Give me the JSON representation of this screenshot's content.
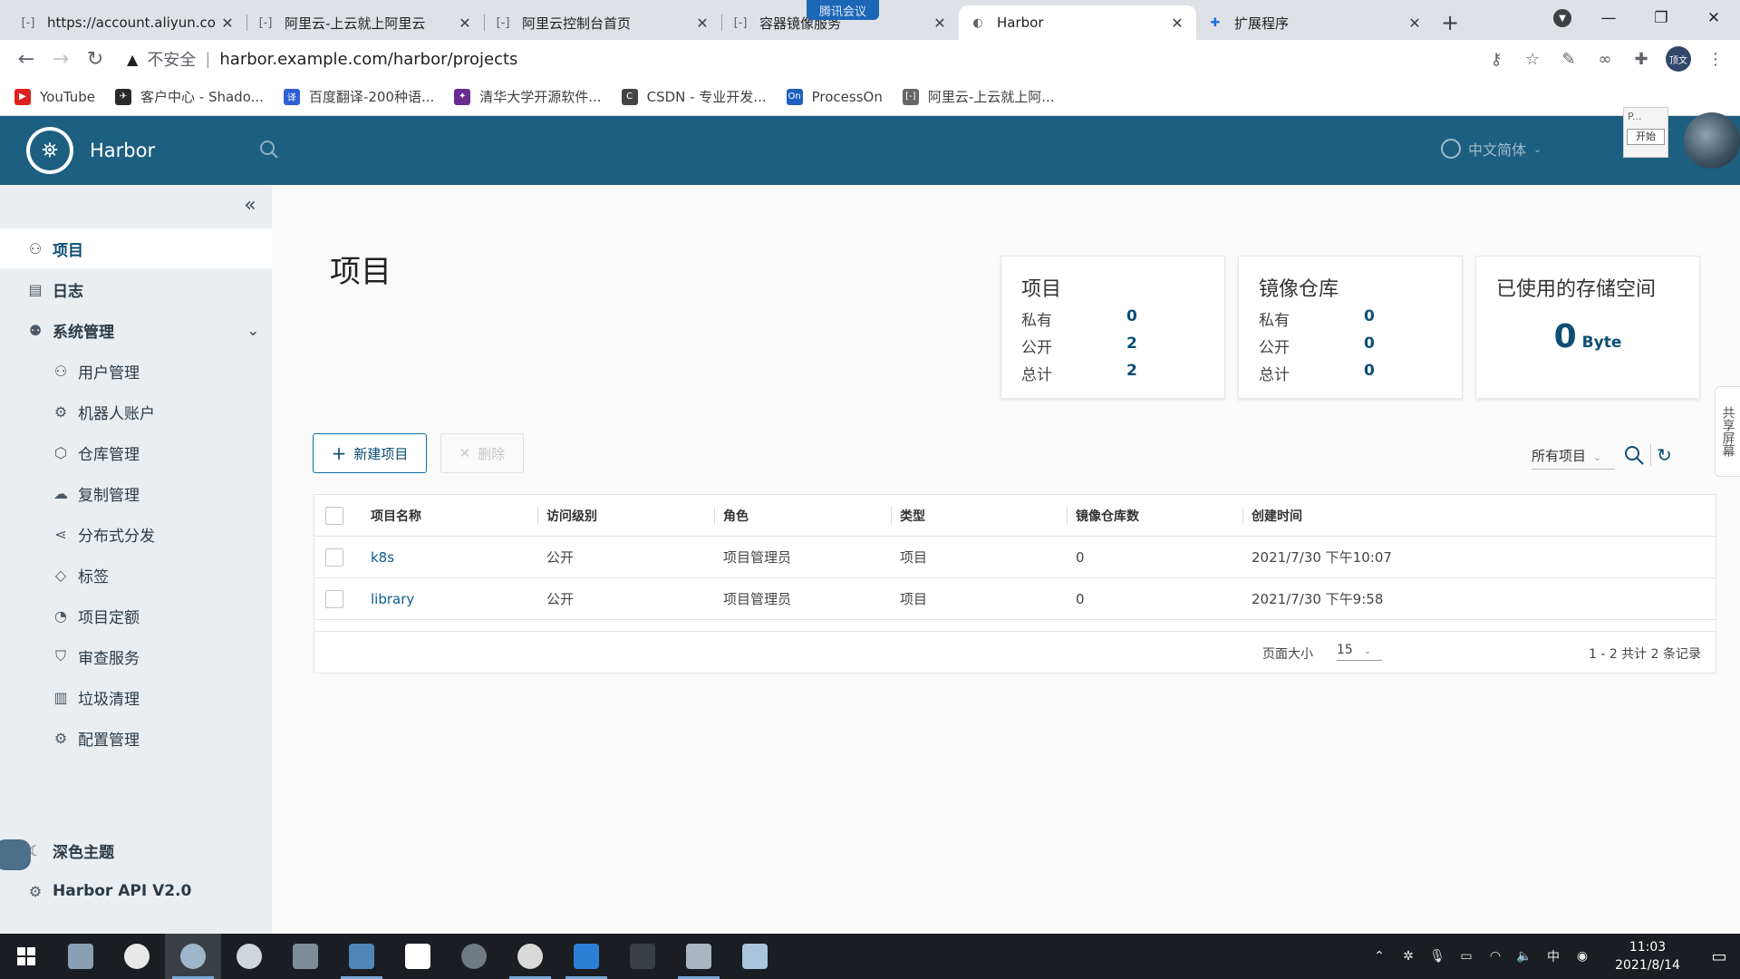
{
  "browser": {
    "tabs": [
      {
        "title": "https://account.aliyun.co",
        "icon": "page-icon",
        "active": false
      },
      {
        "title": "阿里云-上云就上阿里云",
        "icon": "page-icon",
        "active": false
      },
      {
        "title": "阿里云控制台首页",
        "icon": "page-icon",
        "active": false
      },
      {
        "title": "容器镜像服务",
        "icon": "page-icon",
        "active": false
      },
      {
        "title": "Harbor",
        "icon": "harbor-icon",
        "active": true
      },
      {
        "title": "扩展程序",
        "icon": "puzzle-icon",
        "active": false
      }
    ],
    "meeting_badge": "腾讯会议",
    "address": {
      "security_label": "不安全",
      "url": "harbor.example.com/harbor/projects"
    },
    "profile_initials": "顶文",
    "bookmarks": [
      {
        "label": "YouTube",
        "color": "#e02020"
      },
      {
        "label": "客户中心 - Shado...",
        "color": "#2a2a2a"
      },
      {
        "label": "百度翻译-200种语...",
        "color": "#2f5fd6"
      },
      {
        "label": "清华大学开源软件...",
        "color": "#6a2c91"
      },
      {
        "label": "CSDN - 专业开发...",
        "color": "#444444"
      },
      {
        "label": "ProcessOn",
        "color": "#1f5fbf"
      },
      {
        "label": "阿里云-上云就上阿...",
        "color": "#666666"
      }
    ]
  },
  "harbor": {
    "brand": "Harbor",
    "language": "中文简体",
    "overlay": {
      "text": "P...",
      "button": "开始"
    },
    "sidebar": {
      "items": [
        {
          "label": "项目",
          "icon": "project-icon"
        },
        {
          "label": "日志",
          "icon": "log-icon"
        },
        {
          "label": "系统管理",
          "icon": "admin-icon"
        },
        {
          "label": "用户管理",
          "icon": "users-icon"
        },
        {
          "label": "机器人账户",
          "icon": "robot-icon"
        },
        {
          "label": "仓库管理",
          "icon": "registry-icon"
        },
        {
          "label": "复制管理",
          "icon": "replication-icon"
        },
        {
          "label": "分布式分发",
          "icon": "share-icon"
        },
        {
          "label": "标签",
          "icon": "tag-icon"
        },
        {
          "label": "项目定额",
          "icon": "quota-icon"
        },
        {
          "label": "审查服务",
          "icon": "shield-icon"
        },
        {
          "label": "垃圾清理",
          "icon": "trash-icon"
        },
        {
          "label": "配置管理",
          "icon": "gear-icon"
        }
      ],
      "dark_theme": "深色主题",
      "api": "Harbor API V2.0"
    },
    "page_title": "项目",
    "cards": {
      "projects": {
        "title": "项目",
        "rows": [
          {
            "k": "私有",
            "v": "0"
          },
          {
            "k": "公开",
            "v": "2"
          },
          {
            "k": "总计",
            "v": "2"
          }
        ]
      },
      "repos": {
        "title": "镜像仓库",
        "rows": [
          {
            "k": "私有",
            "v": "0"
          },
          {
            "k": "公开",
            "v": "0"
          },
          {
            "k": "总计",
            "v": "0"
          }
        ]
      },
      "storage": {
        "title": "已使用的存储空间",
        "value": "0",
        "unit": "Byte"
      }
    },
    "actions": {
      "new_project": "新建项目",
      "delete": "删除"
    },
    "filter": {
      "value": "所有项目"
    },
    "table": {
      "headers": [
        "项目名称",
        "访问级别",
        "角色",
        "类型",
        "镜像仓库数",
        "创建时间"
      ],
      "rows": [
        [
          "k8s",
          "公开",
          "项目管理员",
          "项目",
          "0",
          "2021/7/30 下午10:07"
        ],
        [
          "library",
          "公开",
          "项目管理员",
          "项目",
          "0",
          "2021/7/30 下午9:58"
        ]
      ]
    },
    "pagination": {
      "page_size_label": "页面大小",
      "page_size": "15",
      "summary": "1 - 2 共计 2 条记录"
    },
    "right_tab": "共享屏幕"
  },
  "taskbar": {
    "time": "11:03",
    "date": "2021/8/14",
    "ime": "中"
  },
  "colors": {
    "header": "#1d5f80",
    "accent": "#0c4e75",
    "sidebar_bg": "#eaeef1"
  }
}
